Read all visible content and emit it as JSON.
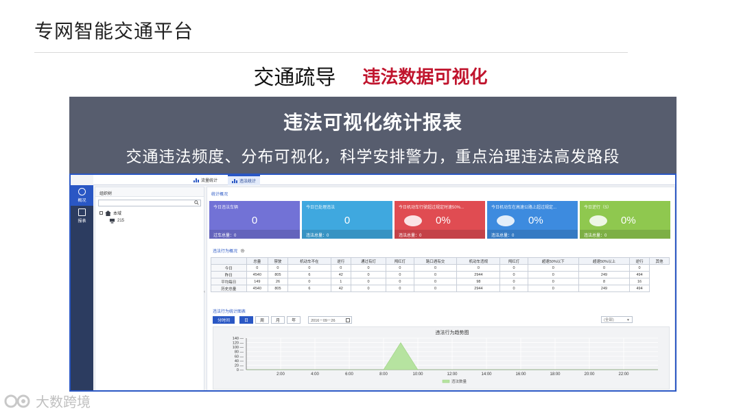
{
  "slide": {
    "title": "专网智能交通平台",
    "heading": "交通疏导",
    "heading_accent": "违法数据可视化",
    "banner_title": "违法可视化统计报表",
    "banner_subtitle": "交通违法频度、分布可视化，科学安排警力，重点治理违法高发路段",
    "watermark": "大数跨境"
  },
  "app": {
    "tabs": [
      {
        "label": "流量统计",
        "active": false
      },
      {
        "label": "违法统计",
        "active": true
      }
    ],
    "rail": [
      {
        "label": "概况",
        "active": true
      },
      {
        "label": "报表",
        "active": false
      }
    ],
    "tree": {
      "title": "组织树",
      "search_value": "",
      "root": "本域",
      "child": "215"
    },
    "overview_title": "统计概况",
    "cards": [
      {
        "title": "今日违法车辆",
        "value": "0",
        "footer": "过车总量：0",
        "color": "#7272d6",
        "style": "num"
      },
      {
        "title": "今日已处理违法",
        "value": "0",
        "footer": "违法总量：0",
        "color": "#3fa8df",
        "style": "num"
      },
      {
        "title": "今日机动车行驶超过规定时速50%...",
        "value": "0%",
        "footer": "违法总量：0",
        "color": "#e04c52",
        "style": "pct"
      },
      {
        "title": "今日机动车在高速公路上超过规定...",
        "value": "0%",
        "footer": "违法总量：0",
        "color": "#3d8bdf",
        "style": "pct"
      },
      {
        "title": "今日逆行（S）",
        "value": "0%",
        "footer": "违法总量：0",
        "color": "#8fc84f",
        "style": "pct"
      }
    ],
    "table_title": "违法行为概况",
    "table": {
      "headers": [
        "",
        "总量",
        "禁驶",
        "机动车不在",
        "逆行",
        "通过有灯",
        "闯红灯",
        "路口遇有交",
        "机动车违规",
        "闯红灯",
        "超速50%以下",
        "超速50%以上",
        "逆行",
        "其他"
      ],
      "rows": [
        [
          "今日",
          "0",
          "0",
          "0",
          "0",
          "0",
          "0",
          "0",
          "0",
          "0",
          "0",
          "0",
          "0"
        ],
        [
          "昨日",
          "4540",
          "805",
          "6",
          "42",
          "0",
          "0",
          "0",
          "2944",
          "0",
          "0",
          "249",
          "494"
        ],
        [
          "平均每日",
          "149",
          "26",
          "0",
          "1",
          "0",
          "0",
          "0",
          "98",
          "0",
          "0",
          "8",
          "16"
        ],
        [
          "历史总量",
          "4540",
          "805",
          "6",
          "42",
          "0",
          "0",
          "0",
          "2944",
          "0",
          "0",
          "249",
          "494"
        ]
      ]
    },
    "chart_section_title": "违法行为统计图表",
    "controls": {
      "realtime": "分时间",
      "day": "日",
      "week": "周",
      "month": "月",
      "year": "年",
      "date": "2016－09－26",
      "select": "(全部)"
    }
  },
  "chart_data": {
    "type": "area",
    "title": "违法行为趋势图",
    "x": [
      0,
      1,
      2,
      3,
      4,
      5,
      6,
      7,
      8,
      9,
      10,
      11,
      12,
      13,
      14,
      15,
      16,
      17,
      18,
      19,
      20,
      21,
      22,
      23,
      24
    ],
    "xtick_labels": [
      "2:00",
      "4:00",
      "6:00",
      "8:00",
      "10:00",
      "12:00",
      "14:00",
      "16:00",
      "18:00",
      "20:00",
      "22:00"
    ],
    "xtick_values": [
      2,
      4,
      6,
      8,
      10,
      12,
      14,
      16,
      18,
      20,
      22
    ],
    "series": [
      {
        "name": "违法数量",
        "values": [
          0,
          0,
          0,
          0,
          0,
          0,
          0,
          0,
          0,
          120,
          0,
          0,
          0,
          0,
          0,
          0,
          0,
          0,
          0,
          0,
          0,
          0,
          0,
          0,
          0
        ]
      }
    ],
    "ylim": [
      0,
      140
    ],
    "yticks": [
      0,
      20,
      40,
      60,
      80,
      100,
      120,
      140
    ],
    "series_color": "#b6e3a0",
    "grid": true,
    "legend": "bottom"
  }
}
